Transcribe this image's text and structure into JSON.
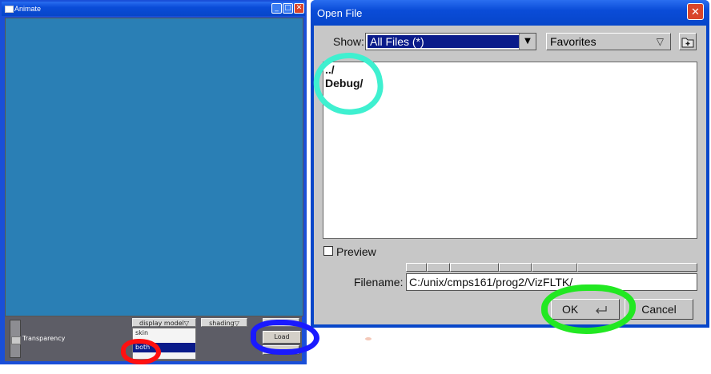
{
  "animate": {
    "title": "Animate",
    "controls": {
      "minimize": "_",
      "maximize": "□",
      "close": "✕"
    },
    "panel": {
      "transparency_label": "Transparency",
      "display_model_label": "display model",
      "display_model_options": [
        "skin",
        "both"
      ],
      "display_model_selected": "both",
      "shading_label": "shading",
      "load_label": "Load"
    }
  },
  "open_file": {
    "title": "Open File",
    "close_glyph": "✕",
    "show_label": "Show:",
    "show_value": "All Files (*)",
    "favorites_label": "Favorites",
    "files": [
      "../",
      "Debug/"
    ],
    "preview_label": "Preview",
    "filename_label": "Filename:",
    "filename_value": "C:/unix/cmps161/prog2/VizFLTK/",
    "ok_label": "OK",
    "cancel_label": "Cancel"
  },
  "colors": {
    "titlebar": "#0746c9",
    "viewport": "#2a7fb5",
    "selection": "#0a1b8a",
    "mark_cyan": "#3ff0d0",
    "mark_blue": "#1a1aff",
    "mark_red": "#ff1010",
    "mark_green": "#22e822"
  },
  "icons": [
    "window-icon",
    "dropdown-arrow-icon",
    "new-folder-icon",
    "enter-key-icon"
  ]
}
